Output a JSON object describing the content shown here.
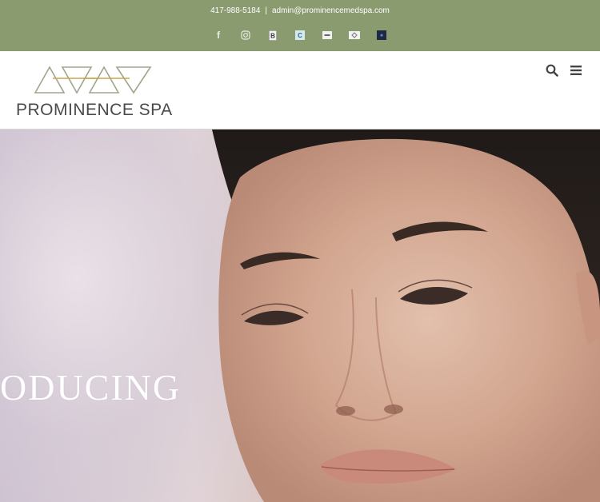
{
  "topbar": {
    "phone": "417-988-5184",
    "separator": "|",
    "email": "admin@prominencemedspa.com",
    "social": [
      {
        "icon": "facebook-icon",
        "glyph": "f"
      },
      {
        "icon": "instagram-icon",
        "glyph": ""
      },
      {
        "icon": "bbb-icon",
        "glyph": ""
      },
      {
        "icon": "care-credit-icon",
        "glyph": ""
      },
      {
        "icon": "link-icon",
        "glyph": ""
      },
      {
        "icon": "spa-icon",
        "glyph": ""
      },
      {
        "icon": "google-plus-icon",
        "glyph": ""
      }
    ],
    "background": "#8a9b70"
  },
  "header": {
    "logo_text": "PROMINENCE SPA",
    "icons": [
      "search-icon",
      "menu-icon"
    ]
  },
  "hero": {
    "headline": "ODUCING"
  },
  "colors": {
    "accent_gold": "#c8a84e",
    "logo_gray": "#a2a58c",
    "text_dark": "#4a4a4a"
  }
}
